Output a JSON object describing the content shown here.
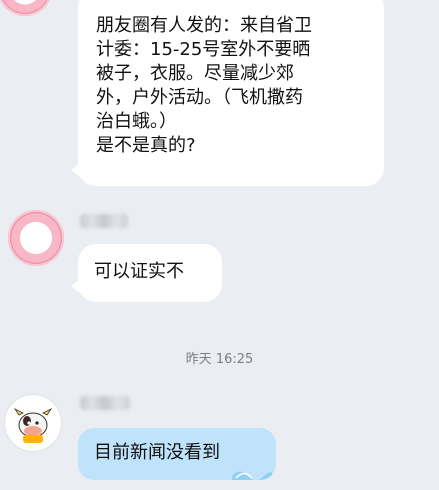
{
  "messages": [
    {
      "sender": "other",
      "avatar": "pink-heart-avatar",
      "text": "朋友圈有人发的：来自省卫\n计委：15-25号室外不要晒\n被子，衣服。尽量减少郊\n外，户外活动。（飞机撒药\n治白蛾。）\n是不是真的?"
    },
    {
      "sender": "other",
      "avatar": "pink-heart-avatar",
      "text": "可以证实不"
    },
    {
      "sender": "other",
      "avatar": "cow-avatar",
      "text": "目前新闻没看到"
    }
  ],
  "timestamp": "昨天 16:25",
  "colors": {
    "background": "#eaedf2",
    "bubble_white": "#ffffff",
    "bubble_blue": "#bfe3fb",
    "timestamp_text": "#7b7f86"
  }
}
